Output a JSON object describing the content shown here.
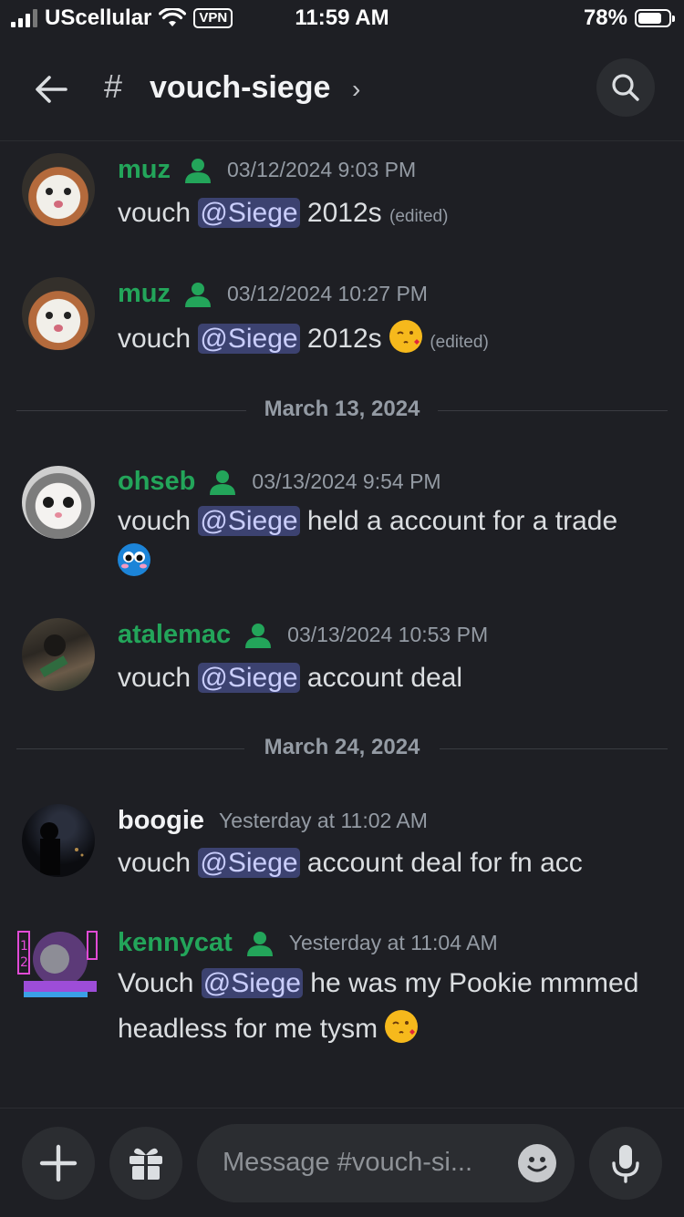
{
  "status": {
    "carrier": "UScellular",
    "vpn": "VPN",
    "time": "11:59 AM",
    "battery": "78%",
    "battery_level": 0.78
  },
  "header": {
    "hash": "#",
    "channel": "vouch-siege",
    "chevron": "›"
  },
  "messages": [
    {
      "user": "muz",
      "timestamp": "03/12/2024 9:03 PM",
      "pre": "vouch ",
      "mention": "@Siege",
      "post": " 2012s",
      "edited": "(edited)"
    },
    {
      "user": "muz",
      "timestamp": "03/12/2024 10:27 PM",
      "pre": "vouch ",
      "mention": "@Siege",
      "post": " 2012s ",
      "emoji": "kissing-heart",
      "edited": "(edited)"
    },
    {
      "user": "ohseb",
      "timestamp": "03/13/2024 9:54 PM",
      "pre": "vouch ",
      "mention": "@Siege",
      "post": " held a account for a trade",
      "emoji": "pleading-face"
    },
    {
      "user": "atalemac",
      "timestamp": "03/13/2024 10:53 PM",
      "pre": "vouch ",
      "mention": "@Siege",
      "post": " account deal"
    },
    {
      "user": "boogie",
      "timestamp": "Yesterday at 11:02 AM",
      "pre": "vouch ",
      "mention": "@Siege",
      "post": " account deal for fn acc"
    },
    {
      "user": "kennycat",
      "timestamp": "Yesterday at 11:04 AM",
      "pre": "Vouch ",
      "mention": "@Siege",
      "post": " he was my Pookie mmmed",
      "line2": "headless for me tysm ",
      "emoji": "kissing-heart"
    }
  ],
  "dividers": [
    "March 13, 2024",
    "March 24, 2024"
  ],
  "composer": {
    "placeholder": "Message #vouch-si..."
  },
  "colors": {
    "background": "#1e1f24",
    "username_green": "#23a55a",
    "mention_bg": "#3c4270",
    "timestamp": "#949ba4"
  }
}
